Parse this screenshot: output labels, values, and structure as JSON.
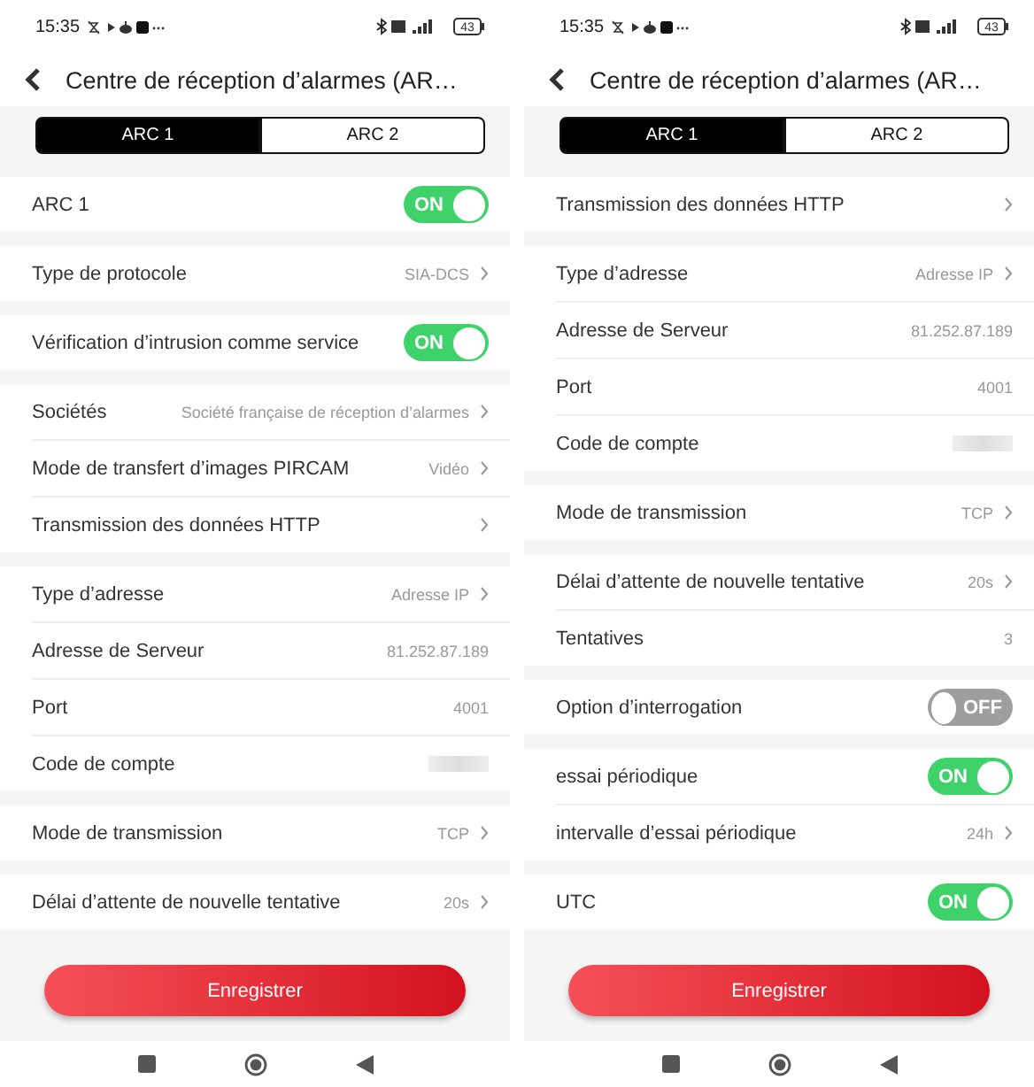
{
  "screens": [
    {
      "status_time": "15:35",
      "battery": "43",
      "title": "Centre de réception d’alarmes (AR…",
      "tabs": [
        {
          "label": "ARC 1",
          "selected": true
        },
        {
          "label": "ARC 2",
          "selected": false
        }
      ],
      "groups": [
        [
          {
            "kind": "toggle",
            "label": "ARC 1",
            "on": true,
            "text": "ON"
          }
        ],
        [
          {
            "kind": "link",
            "label": "Type de protocole",
            "value": "SIA-DCS"
          }
        ],
        [
          {
            "kind": "toggle",
            "label": "Vérification d’intrusion comme service",
            "on": true,
            "text": "ON"
          }
        ],
        [
          {
            "kind": "link",
            "label": "Sociétés",
            "value": "Société française de réception d’alarmes"
          },
          {
            "kind": "link",
            "label": "Mode de transfert d’images PIRCAM",
            "value": "Vidéo"
          },
          {
            "kind": "link",
            "label": "Transmission des données HTTP"
          }
        ],
        [
          {
            "kind": "link",
            "label": "Type d’adresse",
            "value": "Adresse IP"
          },
          {
            "kind": "value",
            "label": "Adresse de Serveur",
            "value": "81.252.87.189"
          },
          {
            "kind": "value",
            "label": "Port",
            "value": "4001"
          },
          {
            "kind": "masked",
            "label": "Code de compte"
          }
        ],
        [
          {
            "kind": "link",
            "label": "Mode de transmission",
            "value": "TCP"
          }
        ],
        [
          {
            "kind": "link",
            "label": "Délai d’attente de nouvelle tentative",
            "value": "20s"
          }
        ]
      ],
      "save": "Enregistrer"
    },
    {
      "status_time": "15:35",
      "battery": "43",
      "title": "Centre de réception d’alarmes (AR…",
      "tabs": [
        {
          "label": "ARC 1",
          "selected": true
        },
        {
          "label": "ARC 2",
          "selected": false
        }
      ],
      "groups": [
        [
          {
            "kind": "link",
            "label": "Transmission des données HTTP"
          }
        ],
        [
          {
            "kind": "link",
            "label": "Type d’adresse",
            "value": "Adresse IP"
          },
          {
            "kind": "value",
            "label": "Adresse de Serveur",
            "value": "81.252.87.189"
          },
          {
            "kind": "value",
            "label": "Port",
            "value": "4001"
          },
          {
            "kind": "masked",
            "label": "Code de compte"
          }
        ],
        [
          {
            "kind": "link",
            "label": "Mode de transmission",
            "value": "TCP"
          }
        ],
        [
          {
            "kind": "link",
            "label": "Délai d’attente de nouvelle tentative",
            "value": "20s"
          },
          {
            "kind": "value",
            "label": "Tentatives",
            "value": "3"
          }
        ],
        [
          {
            "kind": "toggle",
            "label": "Option d’interrogation",
            "on": false,
            "text": "OFF"
          }
        ],
        [
          {
            "kind": "toggle",
            "label": "essai périodique",
            "on": true,
            "text": "ON"
          },
          {
            "kind": "link",
            "label": "intervalle d’essai périodique",
            "value": "24h"
          }
        ],
        [
          {
            "kind": "toggle",
            "label": "UTC",
            "on": true,
            "text": "ON"
          }
        ]
      ],
      "save": "Enregistrer"
    }
  ]
}
